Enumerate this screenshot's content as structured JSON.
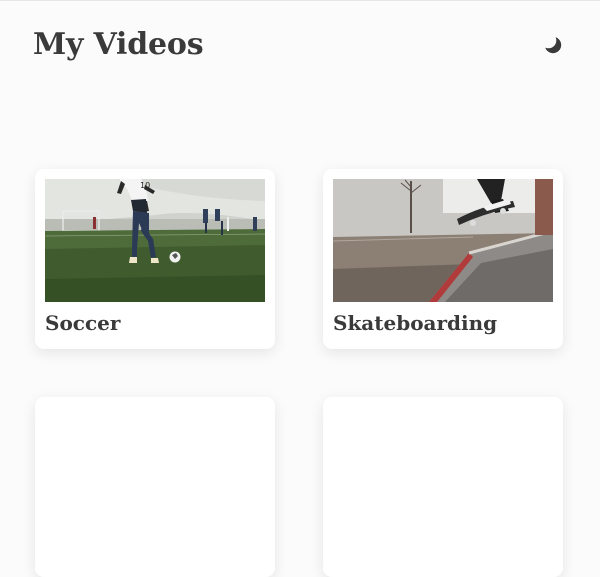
{
  "header": {
    "title": "My Videos",
    "theme_toggle_icon": "moon-icon"
  },
  "videos": [
    {
      "title": "Soccer",
      "thumbnail_icon": "soccer-thumbnail"
    },
    {
      "title": "Skateboarding",
      "thumbnail_icon": "skateboarding-thumbnail"
    },
    {
      "title": "",
      "thumbnail_icon": ""
    },
    {
      "title": "",
      "thumbnail_icon": ""
    }
  ],
  "colors": {
    "background": "#fbfbfb",
    "card": "#ffffff",
    "text": "#3a3a3a"
  }
}
